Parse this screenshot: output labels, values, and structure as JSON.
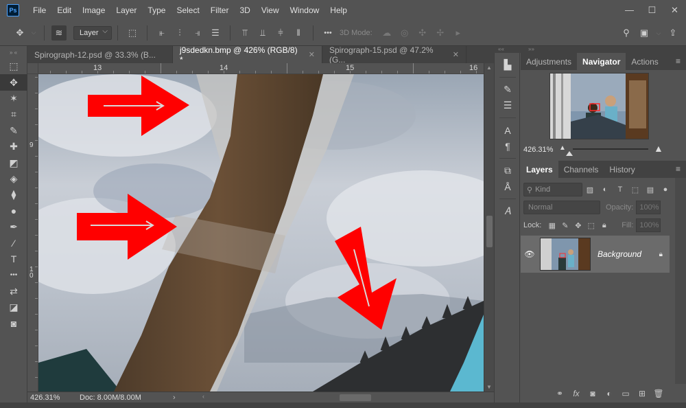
{
  "app": {
    "logo": "Ps",
    "menu": [
      "File",
      "Edit",
      "Image",
      "Layer",
      "Type",
      "Select",
      "Filter",
      "3D",
      "View",
      "Window",
      "Help"
    ],
    "window_controls": {
      "minimize": "—",
      "maximize": "☐",
      "close": "✕"
    }
  },
  "options_bar": {
    "auto_select_target": "Layer",
    "mode_3d_label": "3D Mode:",
    "more_label": "•••"
  },
  "tools": [
    {
      "name": "marquee-icon",
      "glyph": "⬚"
    },
    {
      "name": "move-icon",
      "glyph": "✥",
      "active": true
    },
    {
      "name": "magic-wand-icon",
      "glyph": "✶"
    },
    {
      "name": "crop-icon",
      "glyph": "⌗"
    },
    {
      "name": "brush-icon",
      "glyph": "✎"
    },
    {
      "name": "healing-icon",
      "glyph": "✚"
    },
    {
      "name": "eraser-icon",
      "glyph": "◩"
    },
    {
      "name": "paint-bucket-icon",
      "glyph": "◈"
    },
    {
      "name": "blur-icon",
      "glyph": "⧫"
    },
    {
      "name": "dodge-icon",
      "glyph": "●"
    },
    {
      "name": "pen-icon",
      "glyph": "✒"
    },
    {
      "name": "eyedropper-icon",
      "glyph": "⁄"
    },
    {
      "name": "type-icon",
      "glyph": "T"
    },
    {
      "name": "more-tools-icon",
      "glyph": "•••"
    },
    {
      "name": "swap-colors-icon",
      "glyph": "⇄"
    },
    {
      "name": "color-swatches-icon",
      "glyph": "◪"
    },
    {
      "name": "quick-mask-icon",
      "glyph": "◙"
    }
  ],
  "tabs": [
    {
      "label": "Spirograph-12.psd @ 33.3% (B...",
      "active": false
    },
    {
      "label": "j9sdedkn.bmp @ 426% (RGB/8) *",
      "active": true
    },
    {
      "label": "Spirograph-15.psd @ 47.2% (G...",
      "active": false
    }
  ],
  "rulers": {
    "horizontal": [
      "13",
      "14",
      "15",
      "16"
    ],
    "vertical": [
      "9",
      "1 0"
    ]
  },
  "status": {
    "zoom": "426.31%",
    "doc": "Doc: 8.00M/8.00M",
    "arrow": "›"
  },
  "dock_icons": [
    {
      "name": "histogram-icon",
      "glyph": "▙"
    },
    {
      "name": "brush-settings-icon",
      "glyph": "✎"
    },
    {
      "name": "adjustments-icon",
      "glyph": "☰"
    },
    {
      "name": "character-icon",
      "glyph": "A"
    },
    {
      "name": "paragraph-icon",
      "glyph": "¶"
    },
    {
      "name": "clone-source-icon",
      "glyph": "⧉"
    },
    {
      "name": "glyphs-icon",
      "glyph": "Å"
    },
    {
      "name": "type-style-icon",
      "glyph": "𝐴"
    }
  ],
  "panels": {
    "top_tabs": [
      {
        "label": "Adjustments",
        "active": false
      },
      {
        "label": "Navigator",
        "active": true
      },
      {
        "label": "Actions",
        "active": false
      }
    ],
    "navigator": {
      "zoom": "426.31%"
    },
    "layer_tabs": [
      {
        "label": "Layers",
        "active": true
      },
      {
        "label": "Channels",
        "active": false
      },
      {
        "label": "History",
        "active": false
      }
    ],
    "layers": {
      "kind_placeholder": "Kind",
      "blend_mode": "Normal",
      "opacity_label": "Opacity:",
      "opacity_value": "100%",
      "lock_label": "Lock:",
      "fill_label": "Fill:",
      "fill_value": "100%",
      "items": [
        {
          "name": "Background",
          "locked": true,
          "visible": true
        }
      ]
    }
  },
  "colors": {
    "ui_bg": "#535353",
    "tab_bg": "#424242",
    "arrow_red": "#ff0000",
    "ps_blue": "#4ea3ff"
  }
}
